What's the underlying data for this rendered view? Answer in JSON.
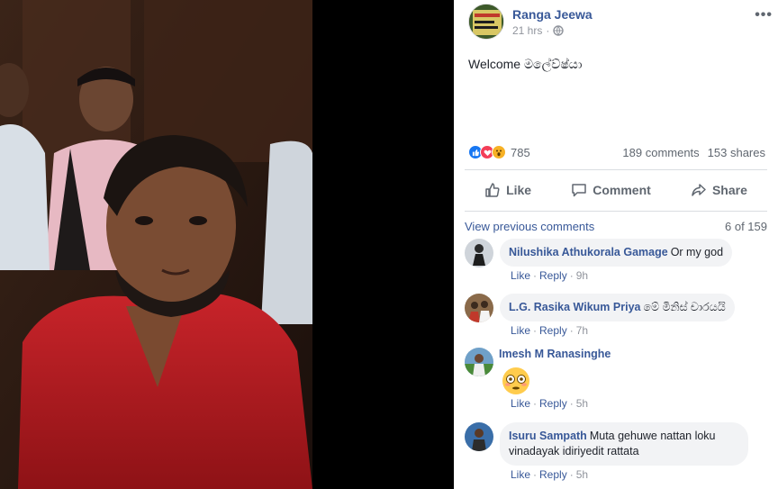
{
  "post": {
    "author": "Ranga Jeewa",
    "time": "21 hrs",
    "privacy_icon": "globe-icon",
    "text": "Welcome මලේව්ෂ්යා",
    "more_label": "•••"
  },
  "stats": {
    "reaction_icons": [
      "like-icon",
      "love-icon",
      "wow-icon"
    ],
    "reaction_count": "785",
    "comments": "189 comments",
    "shares": "153 shares"
  },
  "actions": {
    "like": "Like",
    "comment": "Comment",
    "share": "Share"
  },
  "comments_section": {
    "view_previous": "View previous comments",
    "count": "6 of 159",
    "items": [
      {
        "name": "Nilushika Athukorala Gamage",
        "text": "Or my god",
        "like": "Like",
        "reply": "Reply",
        "time": "9h"
      },
      {
        "name": "L.G. Rasika Wikum Priya",
        "text": "මේ මිනිස් චාරයයි",
        "like": "Like",
        "reply": "Reply",
        "time": "7h"
      },
      {
        "name": "Imesh M Ranasinghe",
        "text": "",
        "emoji": "flushed-face-emoji",
        "like": "Like",
        "reply": "Reply",
        "time": "5h"
      },
      {
        "name": "Isuru Sampath",
        "text": "Muta gehuwe nattan loku vinadayak idiriyedit rattata",
        "like": "Like",
        "reply": "Reply",
        "time": "5h"
      }
    ]
  },
  "colors": {
    "link": "#385898",
    "muted": "#90949c",
    "bubble": "#f2f3f5",
    "like_blue": "#1877f2",
    "love_red": "#f33e58",
    "wow_yellow": "#f7b125"
  }
}
